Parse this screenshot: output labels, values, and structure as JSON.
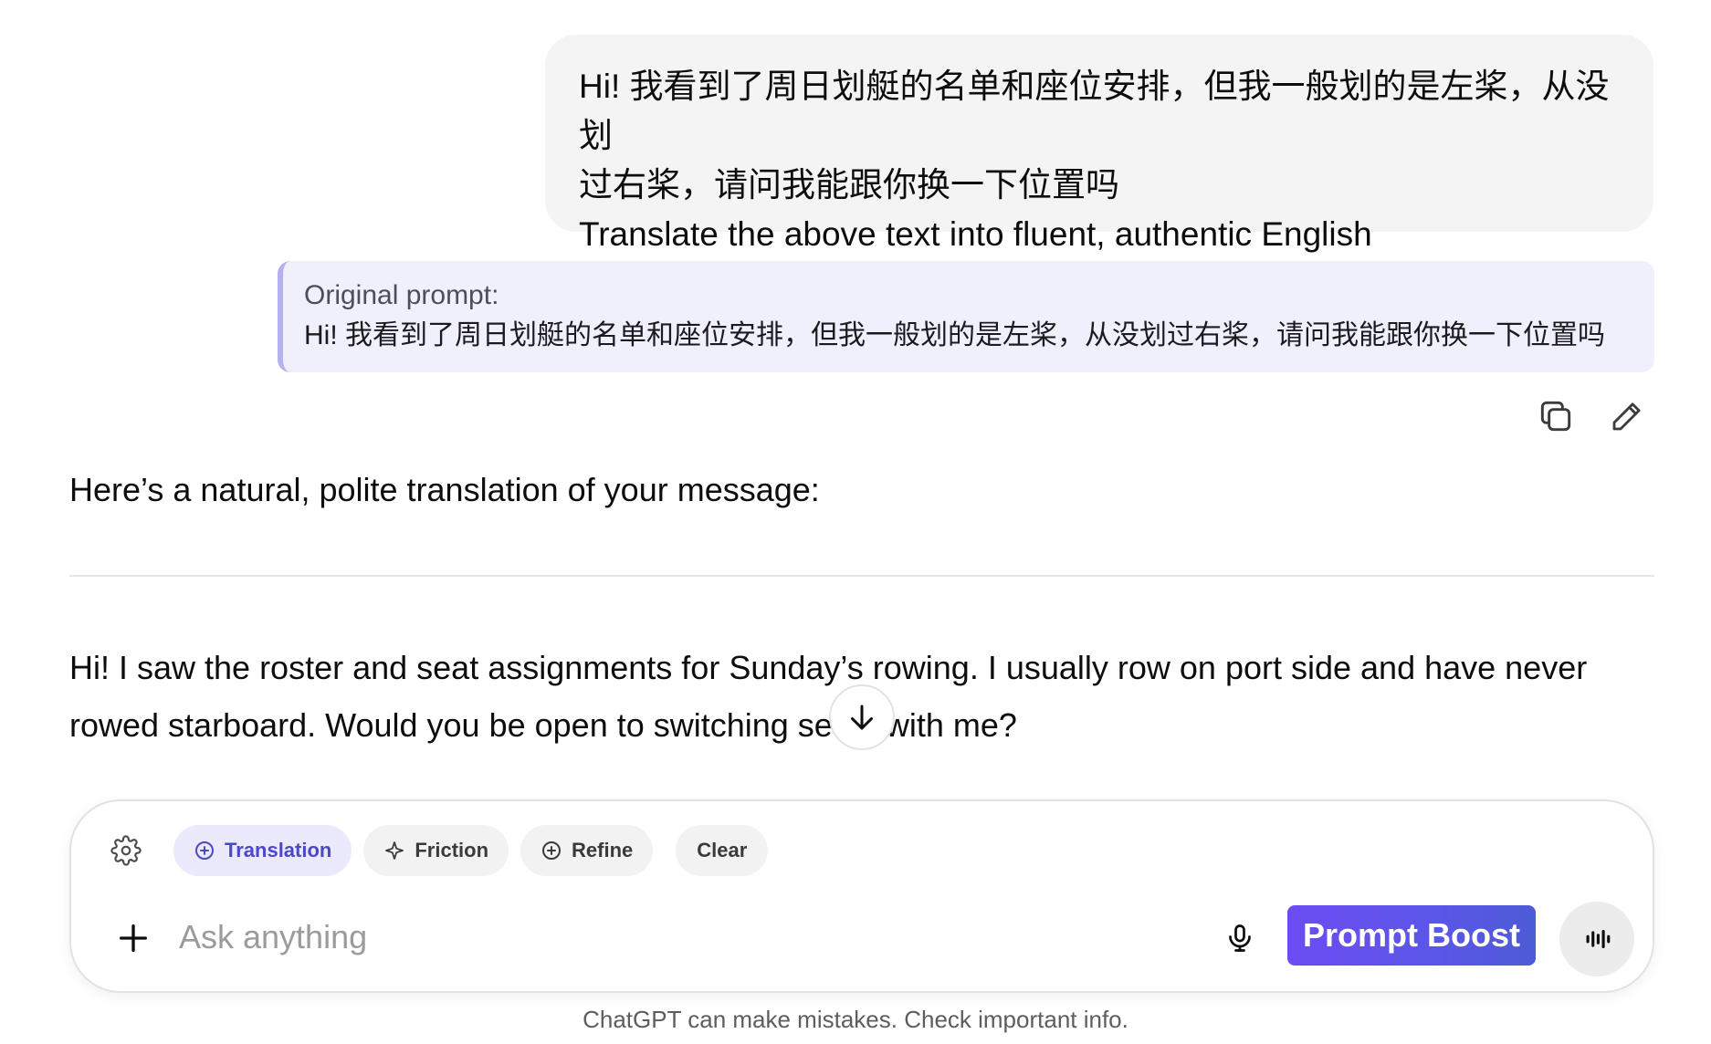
{
  "user_message": {
    "lines": [
      "Hi! 我看到了周日划艇的名单和座位安排，但我一般划的是左桨，从没划",
      "过右桨，请问我能跟你换一下位置吗",
      "Translate the above text into fluent, authentic English"
    ]
  },
  "original_prompt": {
    "label": "Original prompt:",
    "text": "Hi! 我看到了周日划艇的名单和座位安排，但我一般划的是左桨，从没划过右桨，请问我能跟你换一下位置吗"
  },
  "message_actions": [
    {
      "icon": "copy-icon"
    },
    {
      "icon": "pencil-icon"
    }
  ],
  "assistant": {
    "intro": "Here’s a natural, polite translation of your message:",
    "translation": "Hi! I saw the roster and seat assignments for Sunday’s rowing. I usually row on port side and have never rowed starboard. Would you be open to switching seats with me?"
  },
  "composer": {
    "chips": [
      {
        "label": "Translation",
        "icon": "plus-circle-icon",
        "active": true
      },
      {
        "label": "Friction",
        "icon": "sparkle-icon",
        "active": false
      },
      {
        "label": "Refine",
        "icon": "plus-circle-icon",
        "active": false
      },
      {
        "label": "Clear",
        "icon": "",
        "active": false
      }
    ],
    "placeholder": "Ask anything",
    "boost_label": "Prompt Boost"
  },
  "colors": {
    "accent": "#6c4cf2",
    "chip_active_bg": "#ebeafd",
    "chip_active_text": "#4b47c8",
    "original_border": "#b3b1f0"
  },
  "disclaimer": "ChatGPT can make mistakes. Check important info."
}
